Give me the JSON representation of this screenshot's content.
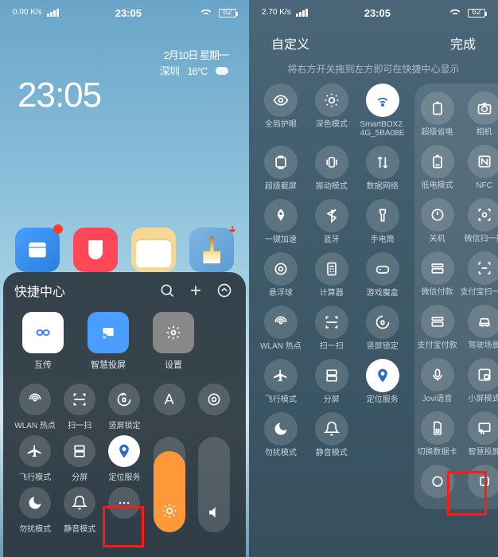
{
  "left": {
    "statusbar": {
      "net_rate": "0.00\nK/s",
      "clock": "23:05",
      "battery": "62"
    },
    "home": {
      "time": "23:05",
      "date": "2月10日 星期一",
      "city": "深圳",
      "temp": "16°C"
    },
    "qc": {
      "title": "快捷中心",
      "apps": [
        {
          "label": "互传"
        },
        {
          "label": "智慧投屏"
        },
        {
          "label": "设置"
        }
      ],
      "tiles": [
        {
          "label": "WLAN 热点",
          "icon": "wifi-hotspot"
        },
        {
          "label": "扫一扫",
          "icon": "scan"
        },
        {
          "label": "竖屏锁定",
          "icon": "rotation-lock"
        },
        {
          "label": "",
          "icon": "font-a"
        },
        {
          "label": "",
          "icon": "gear"
        },
        {
          "label": "飞行模式",
          "icon": "airplane"
        },
        {
          "label": "分屏",
          "icon": "split"
        },
        {
          "label": "定位服务",
          "icon": "location",
          "on": true
        },
        {
          "label": "勿扰模式",
          "icon": "moon"
        },
        {
          "label": "静音模式",
          "icon": "bell"
        },
        {
          "label": "",
          "icon": "more"
        }
      ],
      "brightness_pct": 85
    }
  },
  "right": {
    "statusbar": {
      "net_rate": "2.70\nK/s",
      "clock": "23:05",
      "battery": "62"
    },
    "header": {
      "title": "自定义",
      "done": "完成"
    },
    "subtitle": "将右方开关拖到左方即可在快捷中心显示",
    "main_tiles": [
      {
        "label": "全局护眼",
        "icon": "eye"
      },
      {
        "label": "深色模式",
        "icon": "sun"
      },
      {
        "label": "SmartBOX2.\n4G_5BA08E",
        "icon": "wifi",
        "on": true
      },
      {
        "label": "超级截屏",
        "icon": "screenshot"
      },
      {
        "label": "振动模式",
        "icon": "vibrate"
      },
      {
        "label": "数据网络",
        "icon": "data"
      },
      {
        "label": "一键加速",
        "icon": "rocket"
      },
      {
        "label": "蓝牙",
        "icon": "bluetooth"
      },
      {
        "label": "手电筒",
        "icon": "flashlight"
      },
      {
        "label": "悬浮球",
        "icon": "float"
      },
      {
        "label": "计算器",
        "icon": "calc"
      },
      {
        "label": "游戏魔盒",
        "icon": "game"
      },
      {
        "label": "WLAN 热点",
        "icon": "hotspot"
      },
      {
        "label": "扫一扫",
        "icon": "scan"
      },
      {
        "label": "竖屏锁定",
        "icon": "rotation-lock"
      },
      {
        "label": "飞行模式",
        "icon": "airplane"
      },
      {
        "label": "分屏",
        "icon": "split"
      },
      {
        "label": "定位服务",
        "icon": "location",
        "on": true
      },
      {
        "label": "勿扰模式",
        "icon": "moon"
      },
      {
        "label": "静音模式",
        "icon": "bell"
      }
    ],
    "side_tiles": [
      {
        "label": "超级省电",
        "icon": "battery"
      },
      {
        "label": "相机",
        "icon": "camera"
      },
      {
        "label": "低电模式",
        "icon": "battery-low"
      },
      {
        "label": "NFC",
        "icon": "nfc"
      },
      {
        "label": "关机",
        "icon": "power"
      },
      {
        "label": "微信扫一扫",
        "icon": "wechat-scan"
      },
      {
        "label": "微信付款",
        "icon": "wechat-pay"
      },
      {
        "label": "支付宝扫一扫",
        "icon": "alipay-scan"
      },
      {
        "label": "支付宝付款",
        "icon": "alipay-pay"
      },
      {
        "label": "驾驶场景",
        "icon": "car"
      },
      {
        "label": "Jovi语音",
        "icon": "jovi"
      },
      {
        "label": "小屏模式",
        "icon": "small-screen"
      },
      {
        "label": "切换数据卡",
        "icon": "sim"
      },
      {
        "label": "智慧投屏",
        "icon": "cast"
      },
      {
        "label": "",
        "icon": "misc1"
      },
      {
        "label": "",
        "icon": "misc2"
      }
    ]
  }
}
